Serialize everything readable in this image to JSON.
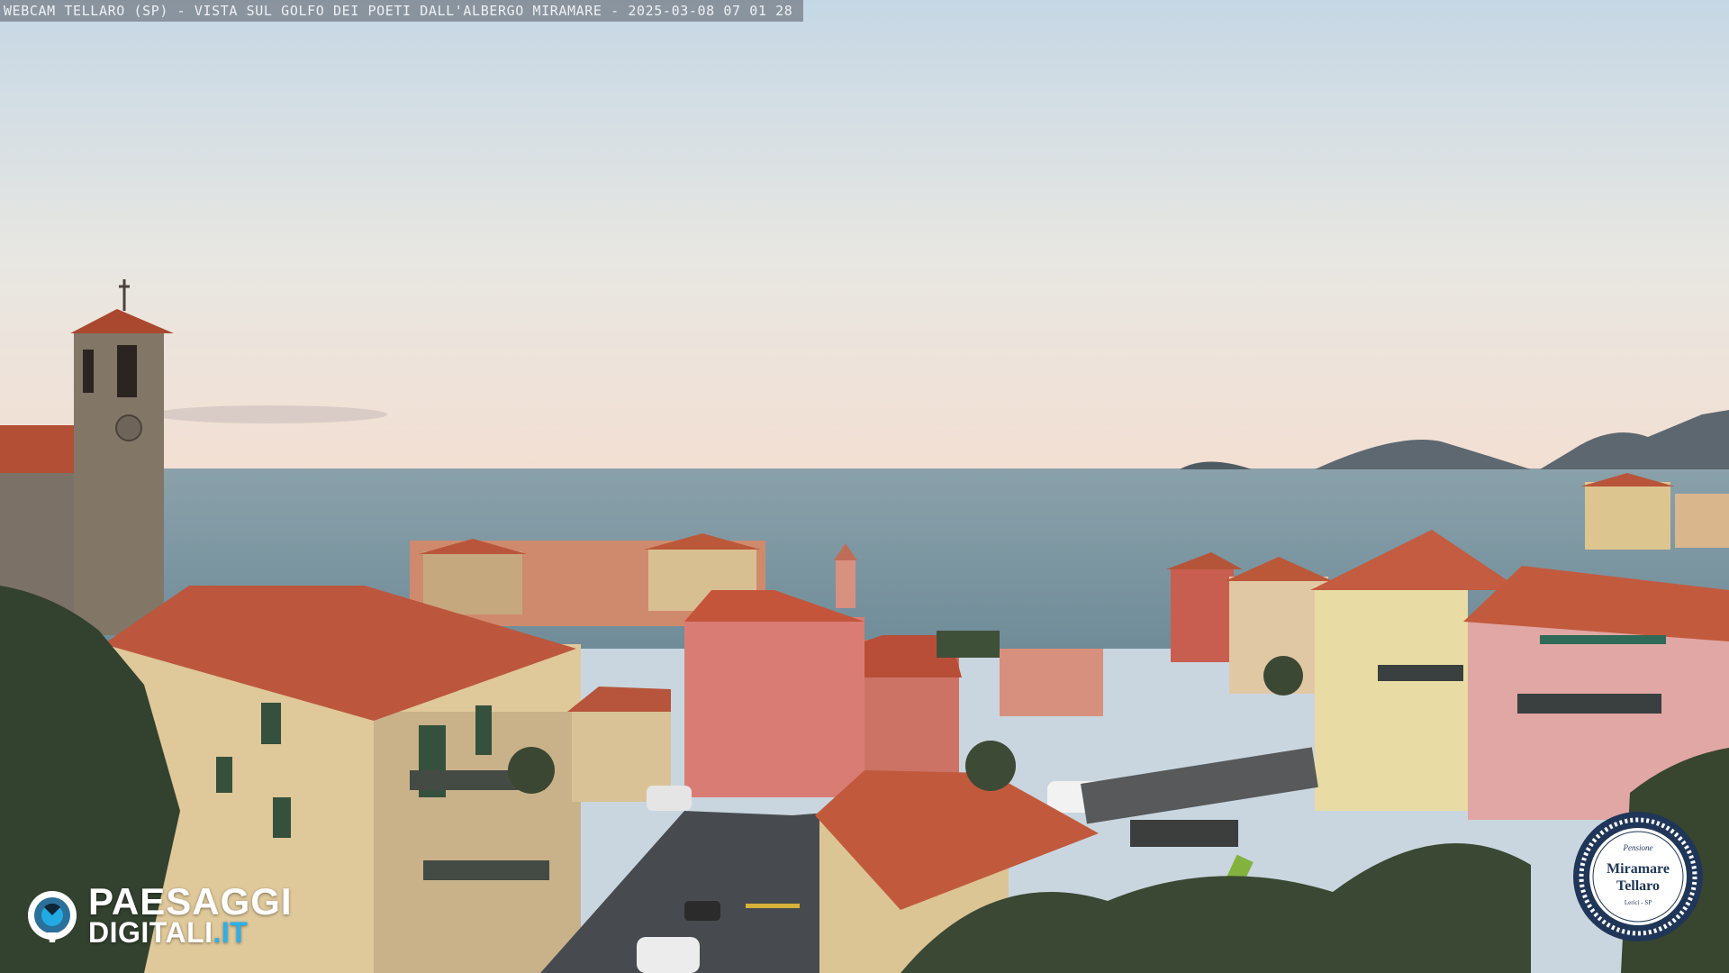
{
  "webcam": {
    "caption": "WEBCAM TELLARO (SP) - VISTA SUL GOLFO DEI POETI DALL'ALBERGO MIRAMARE - 2025-03-08 07 01 28"
  },
  "scene": {
    "subject": "Tellaro village rooftops, church bell tower and sea at dawn",
    "colors": {
      "sky_top": "#c9d9e6",
      "sky_horizon": "#f4e2d6",
      "sea": "#7e98a3",
      "roof": "#c4553b",
      "wall_yellow": "#e3cfa3",
      "wall_pink": "#d98476",
      "stone": "#7b6f64",
      "vegetation": "#3b4a36"
    }
  },
  "watermark": {
    "brand_main": "PAESAGGI",
    "brand_sub": "DIGITALI",
    "brand_tld": ".IT",
    "icon": "eye-camera-icon"
  },
  "badge": {
    "top_text": "Pensione",
    "line1": "Miramare",
    "line2": "Tellaro",
    "bottom_text": "Lerici - SP",
    "colors": {
      "ring": "#1f3658",
      "inner": "#ffffff"
    }
  }
}
